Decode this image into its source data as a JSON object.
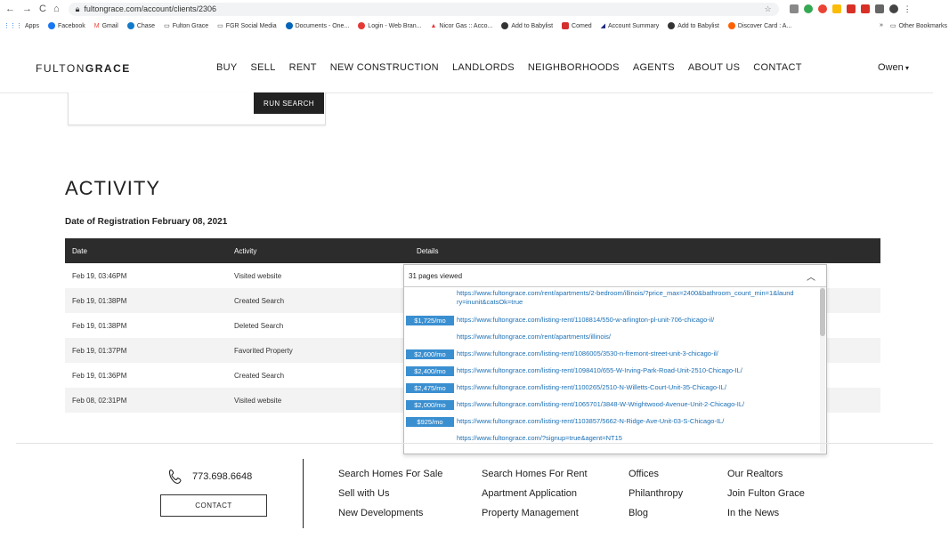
{
  "browser": {
    "url": "fultongrace.com/account/clients/2306",
    "bookmarks": [
      "Apps",
      "Facebook",
      "Gmail",
      "Chase",
      "Fulton Grace",
      "FGR Social Media",
      "Documents - One...",
      "Login - Web Bran...",
      "Nicor Gas :: Acco...",
      "Add to Babylist",
      "Comed",
      "Account Summary",
      "Add to Babylist",
      "Discover Card : A..."
    ],
    "bookmarks_more": "»",
    "other_bookmarks": "Other Bookmarks"
  },
  "header": {
    "logo_light": "FULTON",
    "logo_bold": "GRACE",
    "nav": [
      "BUY",
      "SELL",
      "RENT",
      "NEW CONSTRUCTION",
      "LANDLORDS",
      "NEIGHBORHOODS",
      "AGENTS",
      "ABOUT US",
      "CONTACT"
    ],
    "user": "Owen"
  },
  "search_card": {
    "run_label": "RUN SEARCH"
  },
  "activity": {
    "title": "ACTIVITY",
    "registration": "Date of Registration February 08, 2021",
    "columns": [
      "Date",
      "Activity",
      "Details"
    ],
    "rows": [
      {
        "date": "Feb 19, 03:46PM",
        "activity": "Visited website"
      },
      {
        "date": "Feb 19, 01:38PM",
        "activity": "Created Search"
      },
      {
        "date": "Feb 19, 01:38PM",
        "activity": "Deleted Search"
      },
      {
        "date": "Feb 19, 01:37PM",
        "activity": "Favorited Property"
      },
      {
        "date": "Feb 19, 01:36PM",
        "activity": "Created Search"
      },
      {
        "date": "Feb 08, 02:31PM",
        "activity": "Visited website"
      }
    ]
  },
  "details_dropdown": {
    "selected": "31 pages viewed",
    "items": [
      {
        "price": "",
        "url": "https://www.fultongrace.com/rent/apartments/2-bedroom/illinois/?price_max=2400&bathroom_count_min=1&laundry=inunit&catsOk=true"
      },
      {
        "price": "$1,725/mo",
        "url": "https://www.fultongrace.com/listing-rent/1108814/550-w-arlington-pl-unit-706-chicago-il/"
      },
      {
        "price": "",
        "url": "https://www.fultongrace.com/rent/apartments/illinois/"
      },
      {
        "price": "$2,600/mo",
        "url": "https://www.fultongrace.com/listing-rent/1086005/3530-n-fremont-street-unit-3-chicago-il/"
      },
      {
        "price": "$2,400/mo",
        "url": "https://www.fultongrace.com/listing-rent/1098410/655-W-Irving-Park-Road-Unit-2510-Chicago-IL/"
      },
      {
        "price": "$2,475/mo",
        "url": "https://www.fultongrace.com/listing-rent/1100265/2510-N-Willetts-Court-Unit-35-Chicago-IL/"
      },
      {
        "price": "$2,000/mo",
        "url": "https://www.fultongrace.com/listing-rent/1065701/3848-W-Wrightwood-Avenue-Unit-2-Chicago-IL/"
      },
      {
        "price": "$925/mo",
        "url": "https://www.fultongrace.com/listing-rent/1103857/5662-N-Ridge-Ave-Unit-03-S-Chicago-IL/"
      },
      {
        "price": "",
        "url": "https://www.fultongrace.com/?signup=true&agent=NT15"
      }
    ]
  },
  "footer": {
    "phone": "773.698.6648",
    "contact_label": "CONTACT",
    "col1": [
      "Search Homes For Sale",
      "Sell with Us",
      "New Developments"
    ],
    "col2": [
      "Search Homes For Rent",
      "Apartment Application",
      "Property Management"
    ],
    "col3": [
      "Offices",
      "Philanthropy",
      "Blog"
    ],
    "col4": [
      "Our Realtors",
      "Join Fulton Grace",
      "In the News"
    ]
  }
}
